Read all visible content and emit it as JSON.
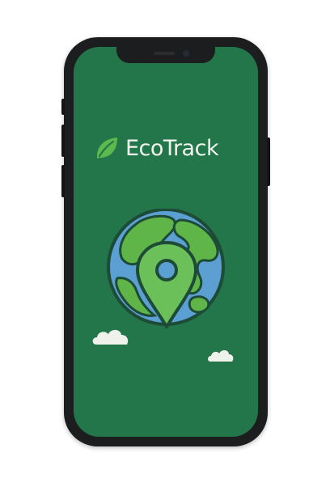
{
  "app": {
    "name": "EcoTrack"
  },
  "icons": {
    "brand": "leaf-icon",
    "illustration": "globe-with-location-pin-icon",
    "decor": "cloud-icon"
  },
  "colors": {
    "screen_background": "#23764a",
    "brand_text": "#f2f5ef",
    "leaf_green": "#5db84d",
    "ocean_blue": "#5b9fd3",
    "land_green": "#5fb547",
    "pin_green": "#6bc05a",
    "outline": "#1d4b37",
    "cloud": "#eef2ea"
  }
}
